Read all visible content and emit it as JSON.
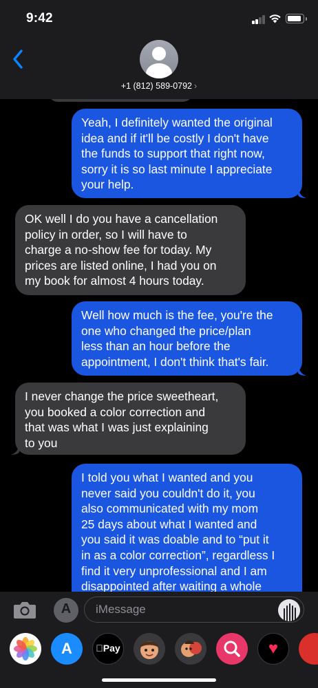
{
  "status_bar": {
    "time": "9:42",
    "signal_bars_filled": 2,
    "signal_bars_total": 4,
    "wifi_icon": "wifi-icon",
    "battery_icon": "battery-icon"
  },
  "header": {
    "back_icon": "chevron-left-icon",
    "avatar_icon": "person-silhouette-icon",
    "contact_number": "+1 (812) 589-0792",
    "contact_chevron": "›"
  },
  "messages": [
    {
      "direction": "sent",
      "lines": [
        "Yeah, I definitely wanted the original",
        "idea and if it'll be costly I don't have",
        "the funds to support that right now,",
        "sorry it is so last minute I appreciate",
        "your help."
      ]
    },
    {
      "direction": "received",
      "lines": [
        "OK well I do you have a cancellation",
        "policy in order, so I will have to",
        "charge a no-show fee for today. My",
        "prices are listed online, I had you on",
        "my book for almost 4 hours today."
      ]
    },
    {
      "direction": "sent",
      "lines": [
        "Well how much is the fee, you're the",
        "one who changed the price/plan",
        "less than an hour before the",
        "appointment, I don't think that's fair."
      ]
    },
    {
      "direction": "received",
      "lines": [
        "I never change the price sweetheart,",
        "you booked a color correction and",
        "that was what I was just explaining",
        "to you"
      ]
    },
    {
      "direction": "sent",
      "lines": [
        "I told you what I wanted and you",
        "never said you couldn't do it, you",
        "also communicated with my mom",
        "25 days about what I wanted and",
        "you said it was doable and to “put it",
        "in as a color correction”, regardless I",
        "find it very unprofessional and I am",
        "disappointed after waiting a whole"
      ]
    }
  ],
  "input_bar": {
    "camera_icon": "camera-icon",
    "apps_icon": "app-store-icon",
    "apps_glyph": "A",
    "placeholder": "iMessage",
    "audio_icon": "waveform-icon"
  },
  "app_drawer": {
    "apps": [
      {
        "name": "photos-icon",
        "label": ""
      },
      {
        "name": "app-store-icon",
        "label": "A"
      },
      {
        "name": "apple-pay-icon",
        "label": "Pay"
      },
      {
        "name": "memoji-icon",
        "label": ""
      },
      {
        "name": "memoji-stickers-icon",
        "label": ""
      },
      {
        "name": "search-images-icon",
        "label": ""
      },
      {
        "name": "digital-touch-icon",
        "label": "♥"
      },
      {
        "name": "extra-app-icon",
        "label": ""
      }
    ]
  },
  "colors": {
    "sent_bubble": "#1a56e0",
    "received_bubble": "#3a3a3c",
    "accent": "#0a84ff",
    "header_bg": "#1c1c1e"
  }
}
